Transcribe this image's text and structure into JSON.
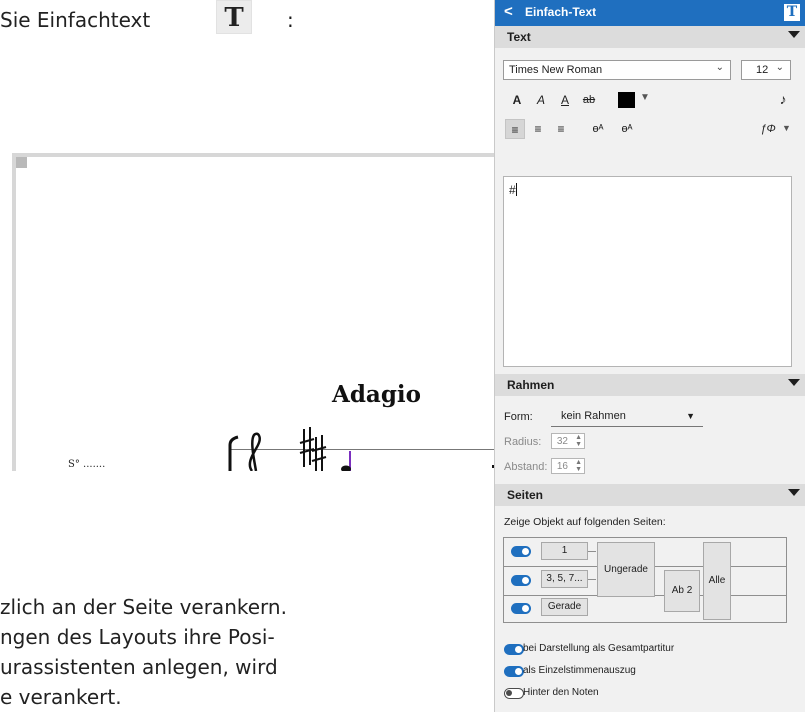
{
  "document": {
    "line_top": "Sie Einfachtext",
    "t_icon": "T",
    "colon": ":",
    "body_lines": [
      "zlich an der Seite verankern.",
      "ngen des Layouts ihre Posi-",
      "urassistenten anlegen, wird",
      "e verankert."
    ],
    "score": {
      "tempo": "Adagio",
      "staff_label": "S° .......",
      "icons": [
        "treble-clef-icon",
        "sharp-icon",
        "note-icon"
      ]
    }
  },
  "panel": {
    "back": "<",
    "title": "Einfach-Text",
    "title_icon": "T",
    "accent": "#1f6fbf",
    "sections": {
      "text": "Text",
      "rahmen": "Rahmen",
      "seiten": "Seiten"
    },
    "font": {
      "family": "Times New Roman",
      "size": "12"
    },
    "format_buttons": {
      "bold": "A",
      "italic": "A",
      "underline": "A",
      "strike": "ab",
      "color": "#000000",
      "music": "♪"
    },
    "align_buttons": {
      "left": "≡",
      "center": "≡",
      "right": "≡",
      "sub": "ɵᴬ",
      "sup": "ɵᴬ",
      "fx": "ƒΦ"
    },
    "textbox_value": "#",
    "rahmen": {
      "form_label": "Form:",
      "form_value": "kein Rahmen",
      "radius_label": "Radius:",
      "radius_value": "32",
      "abstand_label": "Abstand:",
      "abstand_value": "16"
    },
    "seiten": {
      "heading": "Zeige Objekt auf folgenden Seiten:",
      "buttons": {
        "one": "1",
        "odd_list": "3, 5, 7...",
        "even": "Gerade",
        "ungerade": "Ungerade",
        "ab2": "Ab 2",
        "alle": "Alle"
      },
      "options": [
        {
          "label": "bei Darstellung als Gesamtpartitur",
          "on": true
        },
        {
          "label": "als Einzelstimmenauszug",
          "on": true
        },
        {
          "label": "Hinter den Noten",
          "on": false
        }
      ]
    }
  }
}
